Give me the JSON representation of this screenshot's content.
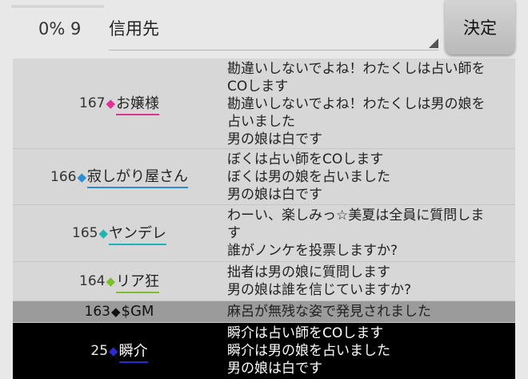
{
  "header": {
    "progress": {
      "percent": 0
    },
    "counter": "0% 9",
    "target_select": {
      "selected": "信用先"
    },
    "decide_label": "決定"
  },
  "log": [
    {
      "number": "167",
      "diamond": "◆",
      "name": "お嬢様",
      "color": "#e0309a",
      "lines": [
        "勘違いしないでよね！わたくしは占い師を",
        "COします",
        "勘違いしないでよね！わたくしは男の娘を",
        "占いました",
        "男の娘は白です"
      ]
    },
    {
      "number": "166",
      "diamond": "◆",
      "name": "寂しがり屋さん",
      "color": "#2a8fd6",
      "lines": [
        "ぼくは占い師をCOします",
        "ぼくは男の娘を占いました",
        "男の娘は白です"
      ]
    },
    {
      "number": "165",
      "diamond": "◆",
      "name": "ヤンデレ",
      "color": "#1fb5b0",
      "lines": [
        "わーい、楽しみっ☆美夏は全員に質問しま",
        "す",
        "誰がノンケを投票しますか?"
      ]
    },
    {
      "number": "164",
      "diamond": "◆",
      "name": "リア狂",
      "color": "#7cbf2a",
      "lines": [
        "拙者は男の娘に質問します",
        "男の娘は誰を信じていますか?"
      ]
    },
    {
      "number": "163",
      "diamond": "◆",
      "name": "$GM",
      "color": "#111111",
      "lines": [
        "麻呂が無残な姿で発見されました"
      ]
    },
    {
      "number": "25",
      "diamond": "◆",
      "name": "瞬介",
      "color": "#2a2ad0",
      "lines": [
        "瞬介は占い師をCOします",
        "瞬介は男の娘を占いました",
        "男の娘は白です"
      ]
    }
  ]
}
